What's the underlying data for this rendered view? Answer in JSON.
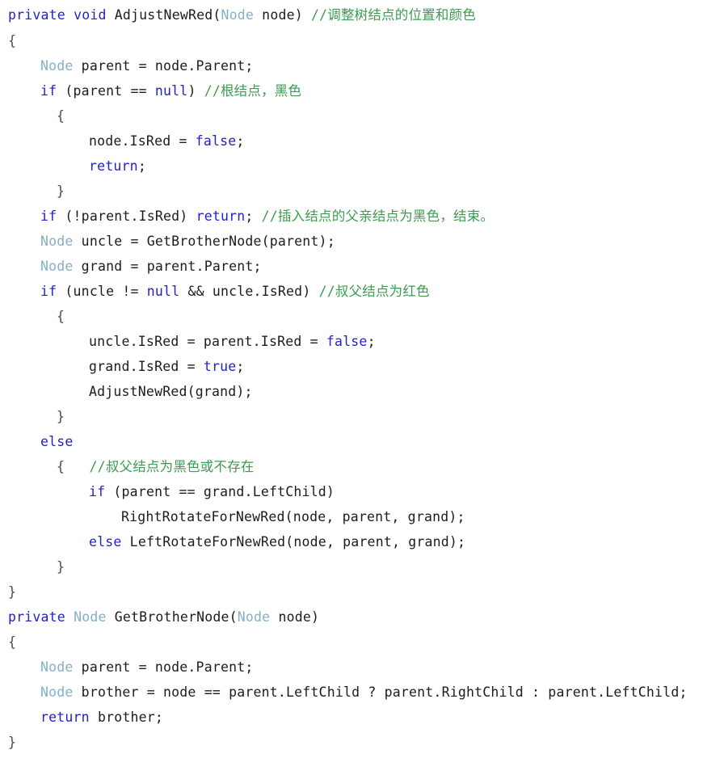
{
  "editor": {
    "title": "AdjustNewRed / GetBrotherNode source listing",
    "language": "C#",
    "background_color": "#ffffff",
    "colors": {
      "keyword": "#2222cc",
      "type": "#84b0c7",
      "comment": "#3b9b4f",
      "plain": "#1c1c1c",
      "brace": "#4a4a4a"
    }
  },
  "code": {
    "lines": [
      {
        "n": 1,
        "indent": 0,
        "tokens": [
          {
            "t": "kw",
            "v": "private"
          },
          {
            "t": "plain",
            "v": " "
          },
          {
            "t": "kw",
            "v": "void"
          },
          {
            "t": "plain",
            "v": " AdjustNewRed("
          },
          {
            "t": "type",
            "v": "Node"
          },
          {
            "t": "plain",
            "v": " node) "
          },
          {
            "t": "cmt",
            "v": "//调整树结点的位置和颜色"
          }
        ]
      },
      {
        "n": 2,
        "indent": 0,
        "tokens": [
          {
            "t": "brace",
            "v": "{"
          }
        ]
      },
      {
        "n": 3,
        "indent": 1,
        "tokens": [
          {
            "t": "type",
            "v": "Node"
          },
          {
            "t": "plain",
            "v": " parent = node.Parent;"
          }
        ]
      },
      {
        "n": 4,
        "indent": 1,
        "tokens": [
          {
            "t": "kw",
            "v": "if"
          },
          {
            "t": "plain",
            "v": " (parent == "
          },
          {
            "t": "kw",
            "v": "null"
          },
          {
            "t": "plain",
            "v": ") "
          },
          {
            "t": "cmt",
            "v": "//根结点，黑色"
          }
        ]
      },
      {
        "n": 5,
        "indent": 1.5,
        "tokens": [
          {
            "t": "brace",
            "v": "{"
          }
        ]
      },
      {
        "n": 6,
        "indent": 2.5,
        "tokens": [
          {
            "t": "plain",
            "v": "node.IsRed = "
          },
          {
            "t": "kw",
            "v": "false"
          },
          {
            "t": "plain",
            "v": ";"
          }
        ]
      },
      {
        "n": 7,
        "indent": 2.5,
        "tokens": [
          {
            "t": "kw",
            "v": "return"
          },
          {
            "t": "plain",
            "v": ";"
          }
        ]
      },
      {
        "n": 8,
        "indent": 1.5,
        "tokens": [
          {
            "t": "brace",
            "v": "}"
          }
        ]
      },
      {
        "n": 9,
        "indent": 1,
        "tokens": [
          {
            "t": "kw",
            "v": "if"
          },
          {
            "t": "plain",
            "v": " (!parent.IsRed) "
          },
          {
            "t": "kw",
            "v": "return"
          },
          {
            "t": "plain",
            "v": "; "
          },
          {
            "t": "cmt",
            "v": "//插入结点的父亲结点为黑色，结束。"
          }
        ]
      },
      {
        "n": 10,
        "indent": 1,
        "tokens": [
          {
            "t": "type",
            "v": "Node"
          },
          {
            "t": "plain",
            "v": " uncle = GetBrotherNode(parent);"
          }
        ]
      },
      {
        "n": 11,
        "indent": 1,
        "tokens": [
          {
            "t": "type",
            "v": "Node"
          },
          {
            "t": "plain",
            "v": " grand = parent.Parent;"
          }
        ]
      },
      {
        "n": 12,
        "indent": 1,
        "tokens": [
          {
            "t": "kw",
            "v": "if"
          },
          {
            "t": "plain",
            "v": " (uncle != "
          },
          {
            "t": "kw",
            "v": "null"
          },
          {
            "t": "plain",
            "v": " && uncle.IsRed) "
          },
          {
            "t": "cmt",
            "v": "//叔父结点为红色"
          }
        ]
      },
      {
        "n": 13,
        "indent": 1.5,
        "tokens": [
          {
            "t": "brace",
            "v": "{"
          }
        ]
      },
      {
        "n": 14,
        "indent": 2.5,
        "tokens": [
          {
            "t": "plain",
            "v": "uncle.IsRed = parent.IsRed = "
          },
          {
            "t": "kw",
            "v": "false"
          },
          {
            "t": "plain",
            "v": ";"
          }
        ]
      },
      {
        "n": 15,
        "indent": 2.5,
        "tokens": [
          {
            "t": "plain",
            "v": "grand.IsRed = "
          },
          {
            "t": "kw",
            "v": "true"
          },
          {
            "t": "plain",
            "v": ";"
          }
        ]
      },
      {
        "n": 16,
        "indent": 2.5,
        "tokens": [
          {
            "t": "plain",
            "v": "AdjustNewRed(grand);"
          }
        ]
      },
      {
        "n": 17,
        "indent": 1.5,
        "tokens": [
          {
            "t": "brace",
            "v": "}"
          }
        ]
      },
      {
        "n": 18,
        "indent": 1,
        "tokens": [
          {
            "t": "kw",
            "v": "else"
          }
        ]
      },
      {
        "n": 19,
        "indent": 1.5,
        "tokens": [
          {
            "t": "brace",
            "v": "{"
          },
          {
            "t": "plain",
            "v": "   "
          },
          {
            "t": "cmt",
            "v": "//叔父结点为黑色或不存在"
          }
        ]
      },
      {
        "n": 20,
        "indent": 2.5,
        "tokens": [
          {
            "t": "kw",
            "v": "if"
          },
          {
            "t": "plain",
            "v": " (parent == grand.LeftChild)"
          }
        ]
      },
      {
        "n": 21,
        "indent": 3.5,
        "tokens": [
          {
            "t": "plain",
            "v": "RightRotateForNewRed(node, parent, grand);"
          }
        ]
      },
      {
        "n": 22,
        "indent": 2.5,
        "tokens": [
          {
            "t": "kw",
            "v": "else"
          },
          {
            "t": "plain",
            "v": " LeftRotateForNewRed(node, parent, grand);"
          }
        ]
      },
      {
        "n": 23,
        "indent": 1.5,
        "tokens": [
          {
            "t": "brace",
            "v": "}"
          }
        ]
      },
      {
        "n": 24,
        "indent": 0,
        "tokens": [
          {
            "t": "brace",
            "v": "}"
          }
        ]
      },
      {
        "n": 25,
        "indent": 0,
        "tokens": [
          {
            "t": "kw",
            "v": "private"
          },
          {
            "t": "plain",
            "v": " "
          },
          {
            "t": "type",
            "v": "Node"
          },
          {
            "t": "plain",
            "v": " GetBrotherNode("
          },
          {
            "t": "type",
            "v": "Node"
          },
          {
            "t": "plain",
            "v": " node)"
          }
        ]
      },
      {
        "n": 26,
        "indent": 0,
        "tokens": [
          {
            "t": "brace",
            "v": "{"
          }
        ]
      },
      {
        "n": 27,
        "indent": 1,
        "tokens": [
          {
            "t": "type",
            "v": "Node"
          },
          {
            "t": "plain",
            "v": " parent = node.Parent;"
          }
        ]
      },
      {
        "n": 28,
        "indent": 1,
        "tokens": [
          {
            "t": "type",
            "v": "Node"
          },
          {
            "t": "plain",
            "v": " brother = node == parent.LeftChild ? parent.RightChild : parent.LeftChild;"
          }
        ]
      },
      {
        "n": 29,
        "indent": 1,
        "tokens": [
          {
            "t": "kw",
            "v": "return"
          },
          {
            "t": "plain",
            "v": " brother;"
          }
        ]
      },
      {
        "n": 30,
        "indent": 0,
        "tokens": [
          {
            "t": "brace",
            "v": "}"
          }
        ]
      }
    ]
  }
}
